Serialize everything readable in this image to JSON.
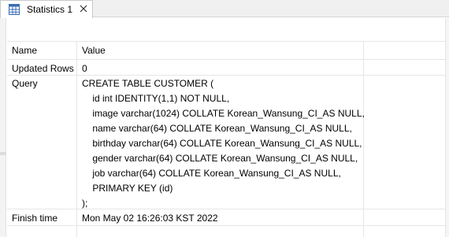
{
  "tab": {
    "label": "Statistics 1",
    "icon": "table-grid-icon",
    "close_icon": "close-icon"
  },
  "table": {
    "columns": [
      "Name",
      "Value"
    ],
    "rows": [
      {
        "name": "Updated Rows",
        "value_lines": [
          "0"
        ]
      },
      {
        "name": "Query",
        "value_lines": [
          "CREATE TABLE CUSTOMER (",
          "    id int IDENTITY(1,1) NOT NULL,",
          "    image varchar(1024) COLLATE Korean_Wansung_CI_AS NULL,",
          "    name varchar(64) COLLATE Korean_Wansung_CI_AS NULL,",
          "    birthday varchar(64) COLLATE Korean_Wansung_CI_AS NULL,",
          "    gender varchar(64) COLLATE Korean_Wansung_CI_AS NULL,",
          "    job varchar(64) COLLATE Korean_Wansung_CI_AS NULL,",
          "    PRIMARY KEY (id)",
          ");"
        ]
      },
      {
        "name": "Finish time",
        "value_lines": [
          "Mon May 02 16:26:03 KST 2022"
        ]
      }
    ]
  }
}
